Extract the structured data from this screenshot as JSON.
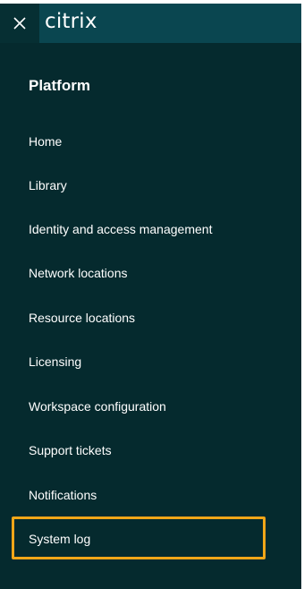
{
  "header": {
    "brand": "citrix",
    "close_icon": "close-icon",
    "topbar_color": "#0a4650",
    "menu_color": "#052a2e",
    "highlight_color": "#f2a618"
  },
  "menu": {
    "section_title": "Platform",
    "items": [
      {
        "label": "Home"
      },
      {
        "label": "Library"
      },
      {
        "label": "Identity and access management"
      },
      {
        "label": "Network locations"
      },
      {
        "label": "Resource locations"
      },
      {
        "label": "Licensing"
      },
      {
        "label": "Workspace configuration"
      },
      {
        "label": "Support tickets"
      },
      {
        "label": "Notifications"
      },
      {
        "label": "System log"
      }
    ],
    "highlighted_item": "System log"
  }
}
